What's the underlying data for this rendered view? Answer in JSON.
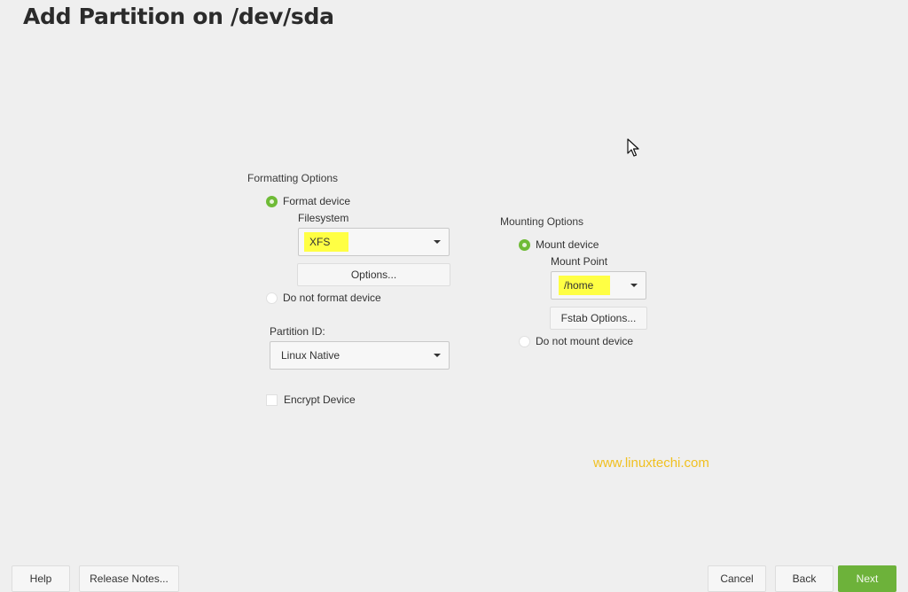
{
  "page": {
    "title": "Add Partition on /dev/sda"
  },
  "formatting": {
    "group_label": "Formatting Options",
    "format_device": {
      "label": "Format device",
      "checked": true
    },
    "filesystem": {
      "label": "Filesystem",
      "value": "XFS",
      "highlighted": true
    },
    "options_button": "Options...",
    "do_not_format": {
      "label": "Do not format device",
      "checked": false
    },
    "partition_id": {
      "label": "Partition ID:",
      "value": "Linux Native"
    },
    "encrypt": {
      "label": "Encrypt Device",
      "checked": false
    }
  },
  "mounting": {
    "group_label": "Mounting Options",
    "mount_device": {
      "label": "Mount device",
      "checked": true
    },
    "mount_point": {
      "label": "Mount Point",
      "value": "/home",
      "highlighted": true
    },
    "fstab_button": "Fstab Options...",
    "do_not_mount": {
      "label": "Do not mount device",
      "checked": false
    }
  },
  "watermark": "www.linuxtechi.com",
  "footer": {
    "help": "Help",
    "release_notes": "Release Notes...",
    "cancel": "Cancel",
    "back": "Back",
    "next": "Next"
  },
  "colors": {
    "accent": "#6db23a",
    "highlight": "#ffff44",
    "watermark": "#f0c020",
    "background": "#efefef"
  }
}
